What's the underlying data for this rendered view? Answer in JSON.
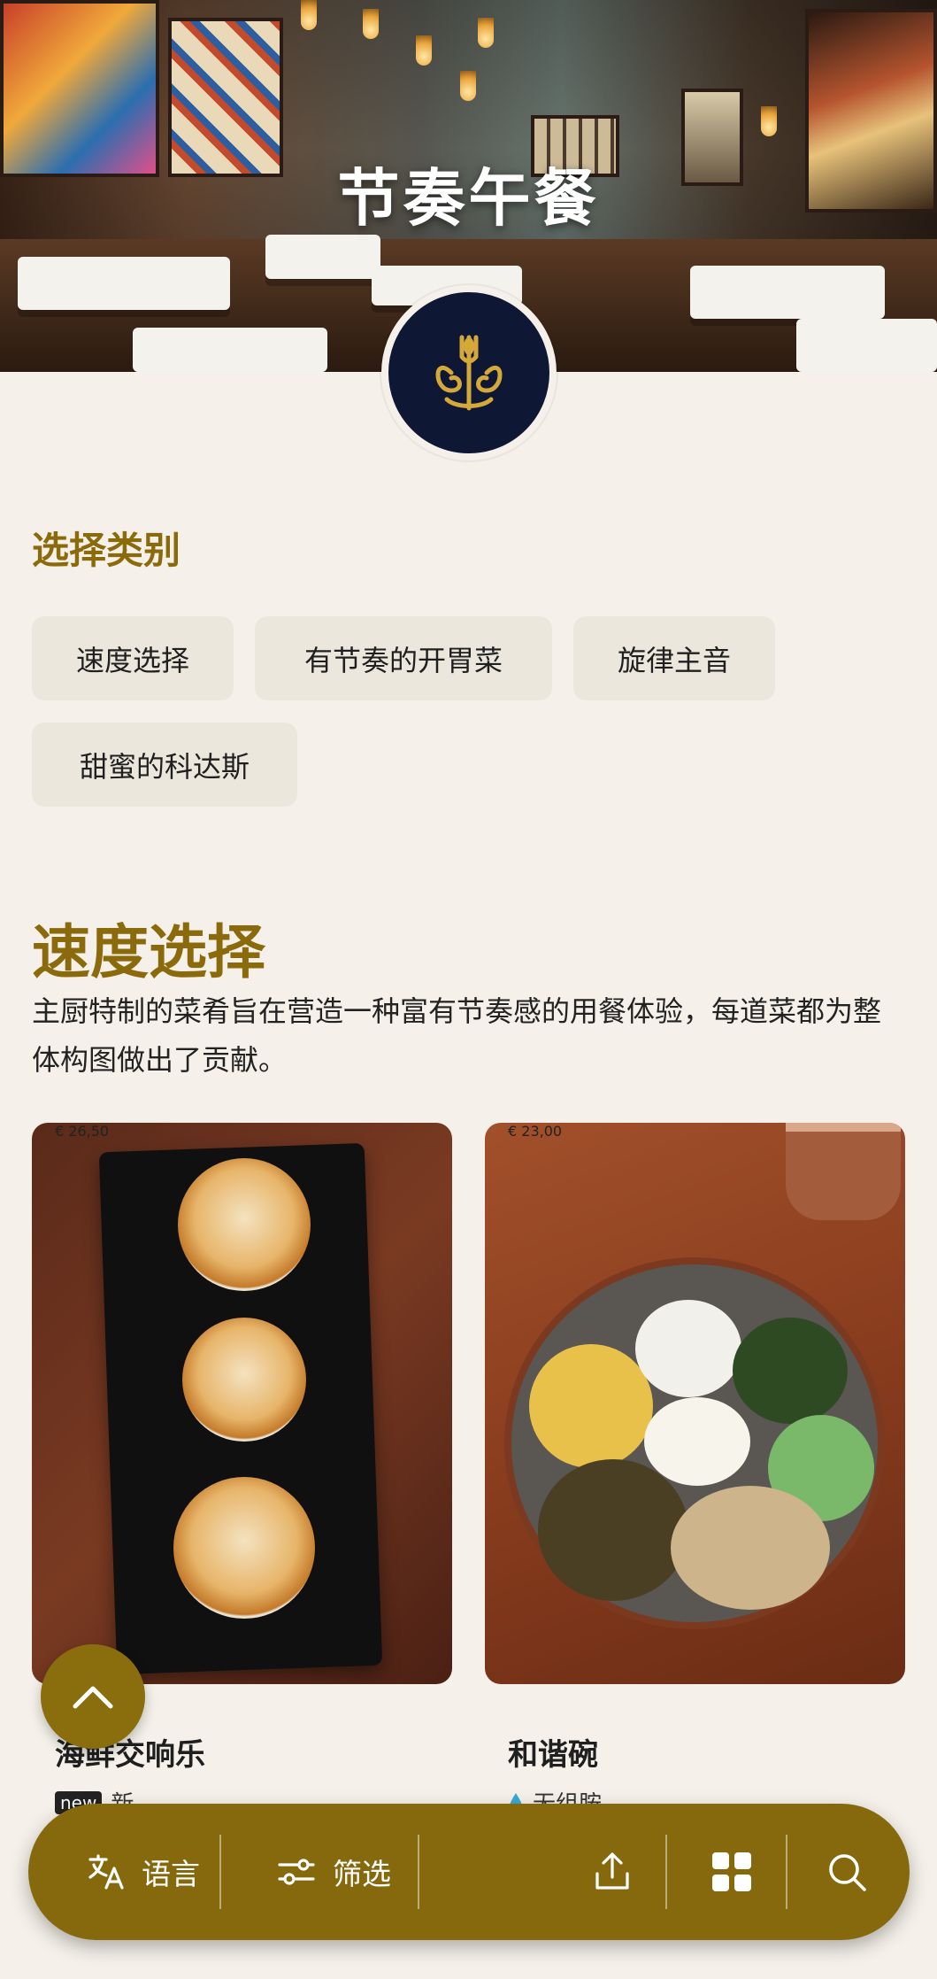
{
  "hero": {
    "title": "节奏午餐"
  },
  "categories": {
    "heading": "选择类别",
    "chips": [
      {
        "label": "速度选择"
      },
      {
        "label": "有节奏的开胃菜"
      },
      {
        "label": "旋律主音"
      },
      {
        "label": "甜蜜的科达斯"
      }
    ]
  },
  "section": {
    "title": "速度选择",
    "description": "主厨特制的菜肴旨在营造一种富有节奏感的用餐体验，每道菜都为整体构图做出了贡献。"
  },
  "items": [
    {
      "name": "海鲜交响乐",
      "badge": "new",
      "tag": "新",
      "price": "€ 26,50"
    },
    {
      "name": "和谐碗",
      "tag": "无组胺",
      "price": "€ 23,00"
    }
  ],
  "bottom_bar": {
    "language_label": "语言",
    "filter_label": "筛选"
  },
  "colors": {
    "accent": "#8b6a0c",
    "bar": "#86690d",
    "chip_bg": "#ebe7dc",
    "page_bg": "#f5f1ea",
    "logo_bg": "#0e1733",
    "logo_gold": "#d4a93a"
  },
  "icons": {
    "logo": "fork-spoon-swirl-icon",
    "scroll_top": "chevron-up-icon",
    "language": "translate-icon",
    "filter": "sliders-icon",
    "share": "share-icon",
    "grid": "grid-icon",
    "search": "search-icon",
    "tag_item2": "drop-icon"
  }
}
